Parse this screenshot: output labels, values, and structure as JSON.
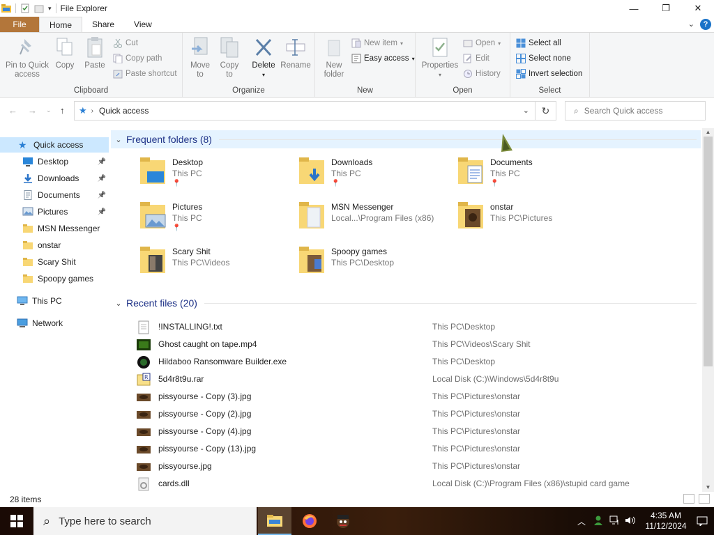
{
  "window": {
    "title": "File Explorer",
    "controls": {
      "minimize": "—",
      "maximize": "❐",
      "close": "✕"
    }
  },
  "ribbon_tabs": [
    "File",
    "Home",
    "Share",
    "View"
  ],
  "ribbon": {
    "clipboard": {
      "label": "Clipboard",
      "pin_quick_access": "Pin to Quick\naccess",
      "pin_line1": "Pin to Quick",
      "pin_line2": "access",
      "copy": "Copy",
      "paste": "Paste",
      "cut": "Cut",
      "copy_path": "Copy path",
      "paste_shortcut": "Paste shortcut"
    },
    "organize": {
      "label": "Organize",
      "move_to_1": "Move",
      "move_to_2": "to",
      "copy_to_1": "Copy",
      "copy_to_2": "to",
      "delete": "Delete",
      "rename": "Rename"
    },
    "new": {
      "label": "New",
      "new_folder_1": "New",
      "new_folder_2": "folder",
      "new_item": "New item",
      "easy_access": "Easy access"
    },
    "open": {
      "label": "Open",
      "properties": "Properties",
      "open": "Open",
      "edit": "Edit",
      "history": "History"
    },
    "select": {
      "label": "Select",
      "select_all": "Select all",
      "select_none": "Select none",
      "invert_selection": "Invert selection"
    }
  },
  "address": {
    "path": "Quick access",
    "search_placeholder": "Search Quick access"
  },
  "sidebar": {
    "quick_access": "Quick access",
    "items": [
      {
        "label": "Desktop",
        "pinned": true,
        "icon": "desktop-icon"
      },
      {
        "label": "Downloads",
        "pinned": true,
        "icon": "downloads-icon"
      },
      {
        "label": "Documents",
        "pinned": true,
        "icon": "documents-icon"
      },
      {
        "label": "Pictures",
        "pinned": true,
        "icon": "pictures-icon"
      },
      {
        "label": "MSN Messenger",
        "pinned": false,
        "icon": "folder-icon"
      },
      {
        "label": "onstar",
        "pinned": false,
        "icon": "folder-icon"
      },
      {
        "label": "Scary Shit",
        "pinned": false,
        "icon": "folder-icon"
      },
      {
        "label": "Spoopy games",
        "pinned": false,
        "icon": "folder-icon"
      }
    ],
    "this_pc": "This PC",
    "network": "Network"
  },
  "frequent": {
    "heading": "Frequent folders (8)",
    "folders": [
      {
        "name": "Desktop",
        "path": "This PC",
        "pinned": true
      },
      {
        "name": "Downloads",
        "path": "This PC",
        "pinned": true
      },
      {
        "name": "Documents",
        "path": "This PC",
        "pinned": true
      },
      {
        "name": "Pictures",
        "path": "This PC",
        "pinned": true
      },
      {
        "name": "MSN Messenger",
        "path": "Local...\\Program Files (x86)",
        "pinned": false
      },
      {
        "name": "onstar",
        "path": "This PC\\Pictures",
        "pinned": false
      },
      {
        "name": "Scary Shit",
        "path": "This PC\\Videos",
        "pinned": false
      },
      {
        "name": "Spoopy games",
        "path": "This PC\\Desktop",
        "pinned": false
      }
    ]
  },
  "recent": {
    "heading": "Recent files (20)",
    "files": [
      {
        "name": "!INSTALLING!.txt",
        "location": "This PC\\Desktop"
      },
      {
        "name": "Ghost caught on tape.mp4",
        "location": "This PC\\Videos\\Scary Shit"
      },
      {
        "name": "Hildaboo Ransomware Builder.exe",
        "location": "This PC\\Desktop"
      },
      {
        "name": "5d4r8t9u.rar",
        "location": "Local Disk (C:)\\Windows\\5d4r8t9u"
      },
      {
        "name": "pissyourse - Copy (3).jpg",
        "location": "This PC\\Pictures\\onstar"
      },
      {
        "name": "pissyourse - Copy (2).jpg",
        "location": "This PC\\Pictures\\onstar"
      },
      {
        "name": "pissyourse - Copy (4).jpg",
        "location": "This PC\\Pictures\\onstar"
      },
      {
        "name": "pissyourse - Copy (13).jpg",
        "location": "This PC\\Pictures\\onstar"
      },
      {
        "name": "pissyourse.jpg",
        "location": "This PC\\Pictures\\onstar"
      },
      {
        "name": "cards.dll",
        "location": "Local Disk (C:)\\Program Files (x86)\\stupid card game"
      }
    ]
  },
  "status": {
    "items": "28 items"
  },
  "taskbar": {
    "search_placeholder": "Type here to search",
    "time": "4:35 AM",
    "date": "11/12/2024"
  },
  "colors": {
    "file_tab": "#b3763a",
    "selection": "#cce8ff",
    "section_heading": "#1e3287",
    "folder_yellow": "#f8d775"
  }
}
